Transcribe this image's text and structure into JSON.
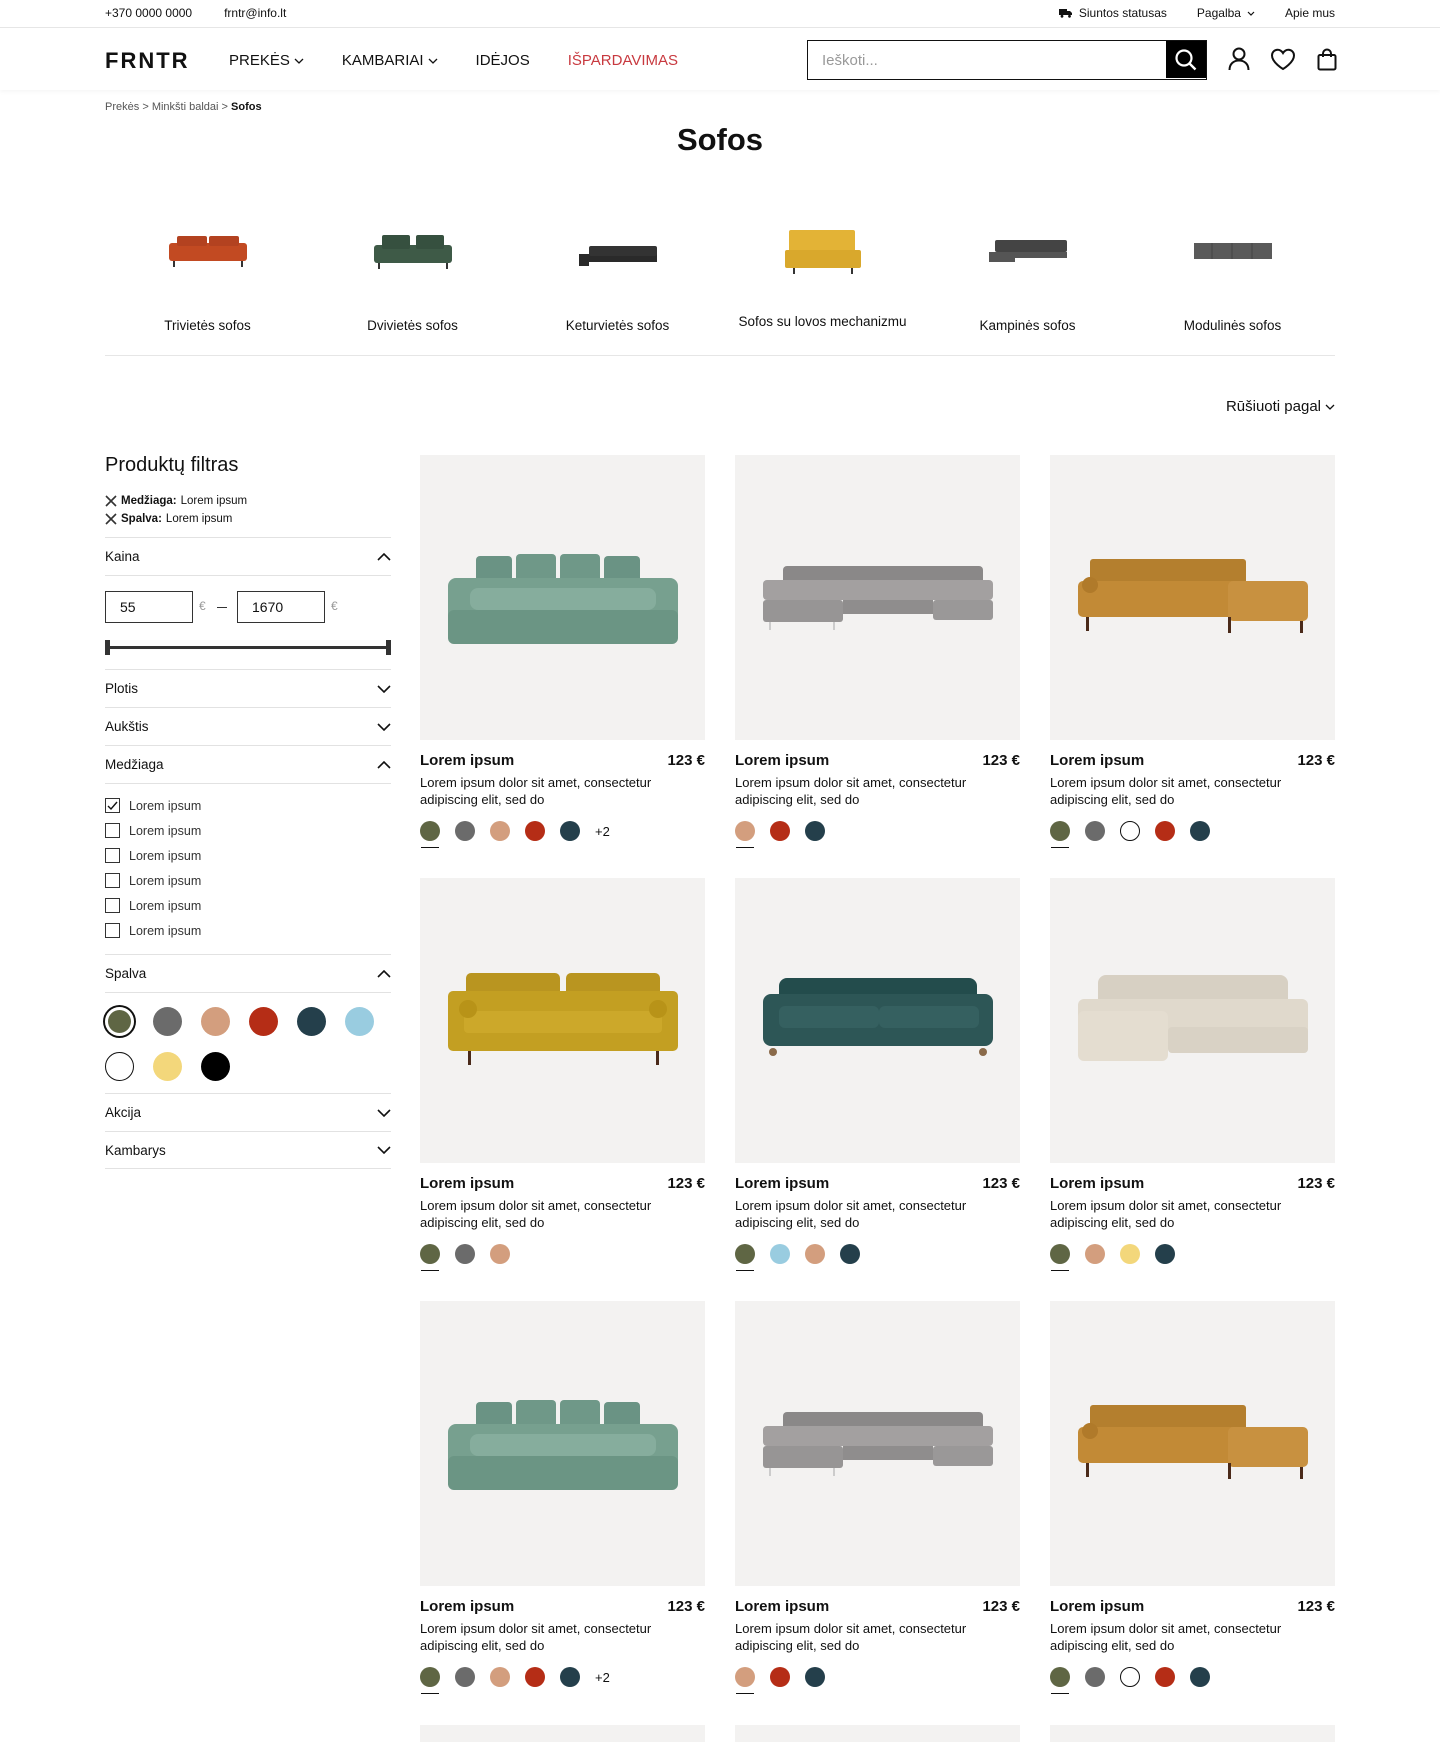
{
  "topbar": {
    "phone": "+370 0000 0000",
    "email": "frntr@info.lt",
    "shipping": "Siuntos statusas",
    "help": "Pagalba",
    "about": "Apie mus"
  },
  "header": {
    "logo": "FRNTR",
    "nav": [
      "PREKĖS",
      "KAMBARIAI",
      "IDĖJOS",
      "IŠPARDAVIMAS"
    ],
    "search_placeholder": "Ieškoti..."
  },
  "breadcrumb": {
    "items": [
      "Prekės",
      "Minkšti baldai"
    ],
    "current": "Sofos",
    "sep": ">"
  },
  "page_title": "Sofos",
  "categories": [
    "Trivietės sofos",
    "Dvivietės sofos",
    "Keturvietės sofos",
    "Sofos su lovos mechanizmu",
    "Kampinės sofos",
    "Modulinės sofos"
  ],
  "sort_label": "Rūšiuoti pagal",
  "filter": {
    "title": "Produktų filtras",
    "active": [
      {
        "key": "Medžiaga:",
        "value": "Lorem ipsum"
      },
      {
        "key": "Spalva:",
        "value": "Lorem ipsum"
      }
    ],
    "price_label": "Kaina",
    "price_min": "55",
    "price_max": "1670",
    "currency": "€",
    "plotis": "Plotis",
    "aukstis": "Aukštis",
    "medziaga": "Medžiaga",
    "material_options": [
      "Lorem ipsum",
      "Lorem ipsum",
      "Lorem ipsum",
      "Lorem ipsum",
      "Lorem ipsum",
      "Lorem ipsum"
    ],
    "material_checked": [
      true,
      false,
      false,
      false,
      false,
      false
    ],
    "spalva": "Spalva",
    "color_swatches": [
      "#5f6644",
      "#6b6b6b",
      "#d39e7e",
      "#b52d16",
      "#243f4b",
      "#99cce0",
      "#ffffff",
      "#f3d77b",
      "#000000"
    ],
    "color_selected": 0,
    "akcija": "Akcija",
    "kambarys": "Kambarys"
  },
  "products": [
    {
      "name": "Lorem ipsum",
      "price": "123 €",
      "desc": "Lorem ipsum dolor sit amet, consectetur adipiscing elit, sed do",
      "image": "sofa-sage",
      "colors": [
        "#5f6644",
        "#6b6b6b",
        "#d39e7e",
        "#b52d16",
        "#243f4b"
      ],
      "more": "+2"
    },
    {
      "name": "Lorem ipsum",
      "price": "123 €",
      "desc": "Lorem ipsum dolor sit amet, consectetur adipiscing elit, sed do",
      "image": "sofa-grey-corner",
      "colors": [
        "#d39e7e",
        "#b52d16",
        "#243f4b"
      ],
      "more": ""
    },
    {
      "name": "Lorem ipsum",
      "price": "123 €",
      "desc": "Lorem ipsum dolor sit amet, consectetur adipiscing elit, sed do",
      "image": "sofa-tan-corner",
      "colors": [
        "#5f6644",
        "#6b6b6b",
        "#ffffff",
        "#b52d16",
        "#243f4b"
      ],
      "more": ""
    },
    {
      "name": "Lorem ipsum",
      "price": "123 €",
      "desc": "Lorem ipsum dolor sit amet, consectetur adipiscing elit, sed do",
      "image": "sofa-mustard",
      "colors": [
        "#5f6644",
        "#6b6b6b",
        "#d39e7e"
      ],
      "more": ""
    },
    {
      "name": "Lorem ipsum",
      "price": "123 €",
      "desc": "Lorem ipsum dolor sit amet, consectetur adipiscing elit, sed do",
      "image": "sofa-teal",
      "colors": [
        "#5f6644",
        "#99cce0",
        "#d39e7e",
        "#243f4b"
      ],
      "more": ""
    },
    {
      "name": "Lorem ipsum",
      "price": "123 €",
      "desc": "Lorem ipsum dolor sit amet, consectetur adipiscing elit, sed do",
      "image": "sofa-cream-corner",
      "colors": [
        "#5f6644",
        "#d39e7e",
        "#f3d77b",
        "#243f4b"
      ],
      "more": ""
    },
    {
      "name": "Lorem ipsum",
      "price": "123 €",
      "desc": "Lorem ipsum dolor sit amet, consectetur adipiscing elit, sed do",
      "image": "sofa-sage",
      "colors": [
        "#5f6644",
        "#6b6b6b",
        "#d39e7e",
        "#b52d16",
        "#243f4b"
      ],
      "more": "+2"
    },
    {
      "name": "Lorem ipsum",
      "price": "123 €",
      "desc": "Lorem ipsum dolor sit amet, consectetur adipiscing elit, sed do",
      "image": "sofa-grey-corner",
      "colors": [
        "#d39e7e",
        "#b52d16",
        "#243f4b"
      ],
      "more": ""
    },
    {
      "name": "Lorem ipsum",
      "price": "123 €",
      "desc": "Lorem ipsum dolor sit amet, consectetur adipiscing elit, sed do",
      "image": "sofa-tan-corner",
      "colors": [
        "#5f6644",
        "#6b6b6b",
        "#ffffff",
        "#b52d16",
        "#243f4b"
      ],
      "more": ""
    }
  ],
  "colors": {
    "sale": "#c8393f",
    "text": "#111111",
    "card_bg": "#f3f2f1"
  }
}
